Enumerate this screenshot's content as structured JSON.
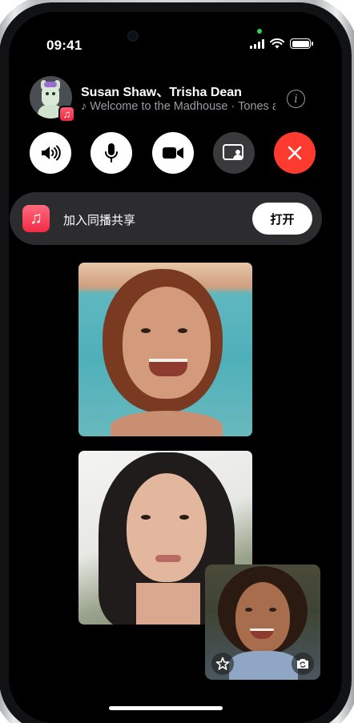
{
  "status_bar": {
    "time": "09:41",
    "icons": [
      "signal-icon",
      "wifi-icon",
      "battery-icon"
    ],
    "battery_level": 1.0
  },
  "call": {
    "names": "Susan Shaw、Trisha Dean",
    "subtitle": "♪ Welcome to the Madhouse · Tones and I",
    "avatar_icon": "llama-avatar-icon",
    "badge_icon": "apple-music-icon",
    "info_icon": "info-icon"
  },
  "controls": [
    {
      "name": "speaker",
      "icon": "speaker-icon"
    },
    {
      "name": "mute",
      "icon": "microphone-icon"
    },
    {
      "name": "camera",
      "icon": "video-camera-icon"
    },
    {
      "name": "share-screen",
      "icon": "shareplay-screen-icon"
    },
    {
      "name": "end-call",
      "icon": "close-icon"
    }
  ],
  "banner": {
    "icon": "apple-music-icon",
    "text": "加入同播共享",
    "button": "打开"
  },
  "self_view": {
    "effects_icon": "effects-star-icon",
    "flip_icon": "flip-camera-icon"
  },
  "colors": {
    "end_call": "#ff3b30",
    "music_red": "#f42a45",
    "control_dark": "#3a3a3c",
    "banner_bg": "#2c2c2e"
  }
}
